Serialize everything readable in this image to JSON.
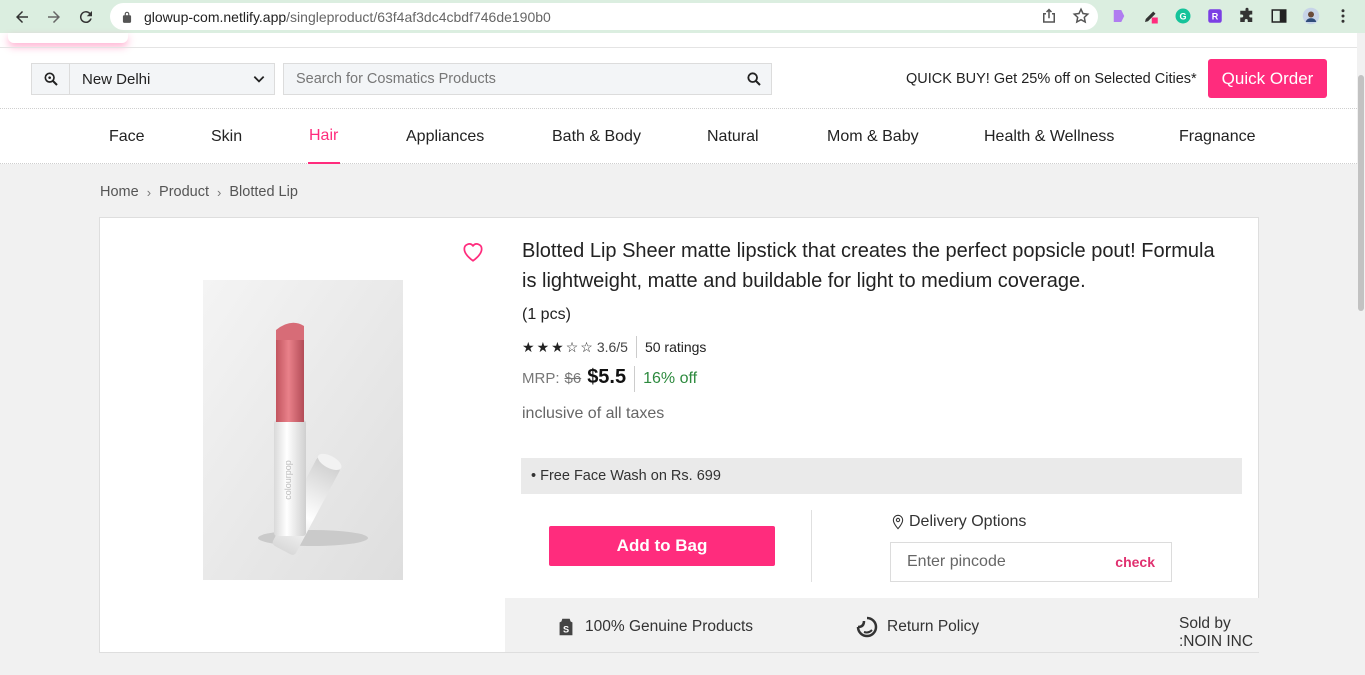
{
  "browser": {
    "url_host": "glowup-com.netlify.app",
    "url_path": "/singleproduct/63f4af3dc4cbdf746de190b0"
  },
  "header": {
    "location": "New Delhi",
    "search_placeholder": "Search for Cosmatics Products",
    "promo": "QUICK BUY! Get 25% off on Selected Cities*",
    "quick_order": "Quick Order"
  },
  "categories": [
    "Face",
    "Skin",
    "Hair",
    "Appliances",
    "Bath & Body",
    "Natural",
    "Mom & Baby",
    "Health & Wellness",
    "Fragnance"
  ],
  "active_category": "Hair",
  "breadcrumb": [
    "Home",
    "Product",
    "Blotted Lip"
  ],
  "product": {
    "title": "Blotted Lip Sheer matte lipstick that creates the perfect popsicle pout! Formula is lightweight, matte and buildable for light to medium coverage.",
    "quantity": "(1 pcs)",
    "rating_value": "3.6/5",
    "rating_stars": 3,
    "ratings_count": "50 ratings",
    "mrp_label": "MRP:",
    "mrp_old": "$6",
    "price": "$5.5",
    "discount": "16% off",
    "taxes": "inclusive of all taxes",
    "offer": "• Free Face Wash on Rs. 699",
    "add_to_bag": "Add to Bag"
  },
  "delivery": {
    "title": "Delivery Options",
    "pincode_placeholder": "Enter pincode",
    "check": "check"
  },
  "assurances": {
    "genuine": "100% Genuine Products",
    "return": "Return Policy",
    "sold_by": "Sold by :NOIN INC"
  },
  "colors": {
    "accent": "#ff2c7d",
    "discount": "#2d8a3e"
  }
}
